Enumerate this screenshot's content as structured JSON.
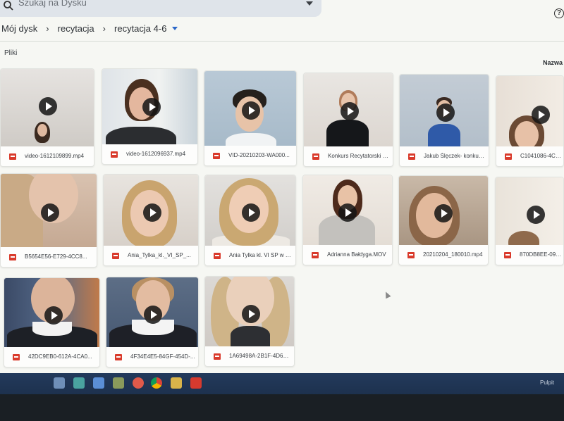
{
  "search": {
    "placeholder": "Szukaj na Dysku"
  },
  "breadcrumb": {
    "items": [
      "Mój dysk",
      "recytacja",
      "recytacja 4-6"
    ]
  },
  "section": {
    "files_label": "Pliki",
    "sort_label": "Nazwa"
  },
  "files": [
    {
      "name": "video-1612109899.mp4"
    },
    {
      "name": "video-1612096937.mp4"
    },
    {
      "name": "VID-20210203-WA000..."
    },
    {
      "name": "Konkurs Recytatorski -..."
    },
    {
      "name": "Jakub Ślęczek- konkur..."
    },
    {
      "name": "C1041086-4C7D-473..."
    },
    {
      "name": "B5654E56-E729-4CC8..."
    },
    {
      "name": "Ania_Tylka_kl._VI_SP_..."
    },
    {
      "name": "Ania Tylka kl. VI SP w K..."
    },
    {
      "name": "Adrianna Bałdyga.MOV"
    },
    {
      "name": "20210204_180010.mp4"
    },
    {
      "name": "870DB8EE-096B-4C03..."
    },
    {
      "name": "42DC9EB0-612A-4CA0..."
    },
    {
      "name": "4F34E4E5-84GF-454D-..."
    },
    {
      "name": "1A69498A-2B1F-4D67..."
    }
  ],
  "taskbar": {
    "clock": "Pulpit"
  },
  "colors": {
    "video_icon": "#d93a2b",
    "accent": "#2b67c9",
    "taskbar": "#1d314e"
  }
}
